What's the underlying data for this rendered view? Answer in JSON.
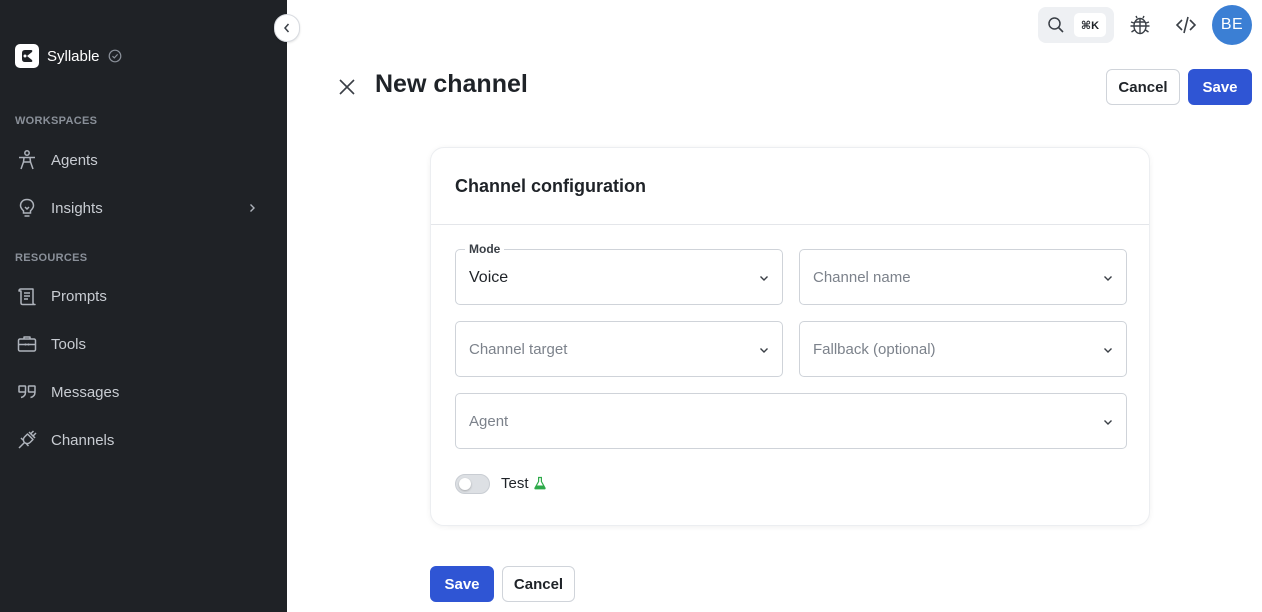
{
  "sidebar": {
    "brand": "Syllable",
    "sections": {
      "workspaces": "WORKSPACES",
      "resources": "RESOURCES"
    },
    "items": [
      {
        "label": "Agents",
        "icon": "agent-icon"
      },
      {
        "label": "Insights",
        "icon": "lightbulb-icon"
      },
      {
        "label": "Prompts",
        "icon": "scroll-icon"
      },
      {
        "label": "Tools",
        "icon": "briefcase-icon"
      },
      {
        "label": "Messages",
        "icon": "quote-icon"
      },
      {
        "label": "Channels",
        "icon": "plug-icon"
      }
    ]
  },
  "topbar": {
    "shortcut": "⌘K",
    "avatar_initials": "BE"
  },
  "header": {
    "title": "New channel",
    "cancel_label": "Cancel",
    "save_label": "Save"
  },
  "form": {
    "title": "Channel configuration",
    "mode": {
      "legend": "Mode",
      "value": "Voice"
    },
    "channel_name": {
      "placeholder": "Channel name"
    },
    "channel_target": {
      "placeholder": "Channel target"
    },
    "fallback": {
      "placeholder": "Fallback (optional)"
    },
    "agent": {
      "placeholder": "Agent"
    },
    "test_toggle": {
      "label": "Test",
      "checked": false
    }
  },
  "footer": {
    "save_label": "Save",
    "cancel_label": "Cancel"
  },
  "colors": {
    "sidebar_bg": "#1f2226",
    "primary": "#2f55d4",
    "avatar": "#3b7fd4",
    "flask": "#2eaa4a"
  }
}
